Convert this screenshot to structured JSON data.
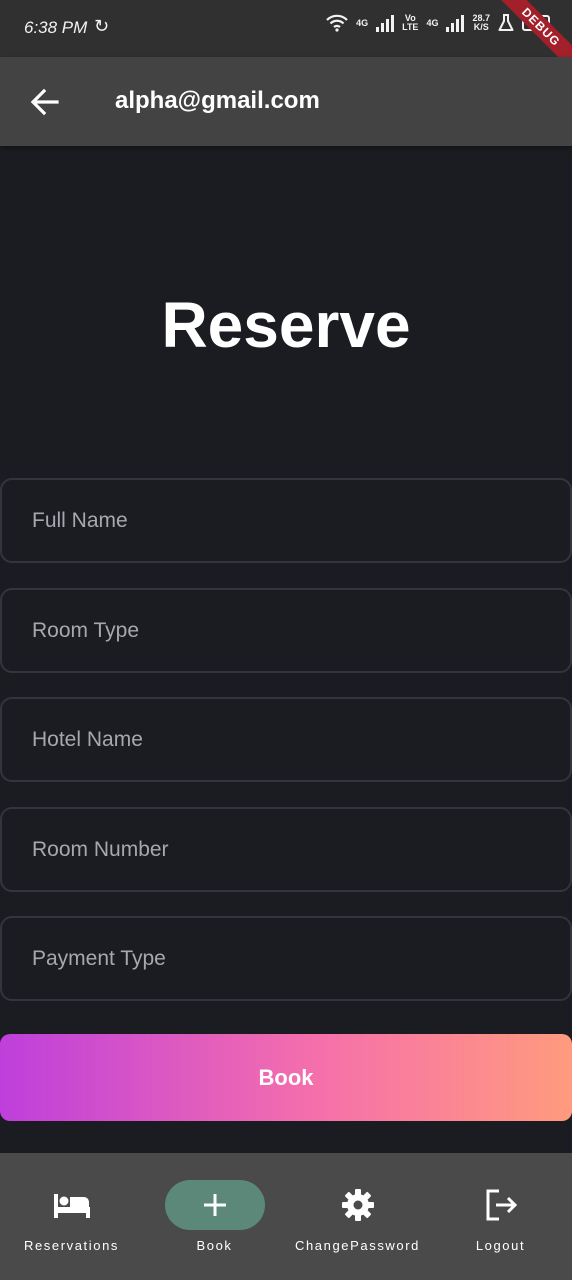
{
  "status_bar": {
    "time": "6:38 PM",
    "net_4g_1": "4G",
    "volte_top": "Vo",
    "volte_bottom": "LTE",
    "net_4g_2": "4G",
    "speed_value": "28.7",
    "speed_unit": "K/S",
    "battery": "100"
  },
  "debug_banner": "DEBUG",
  "app_bar": {
    "title": "alpha@gmail.com"
  },
  "page": {
    "title": "Reserve"
  },
  "form": {
    "fields": [
      {
        "placeholder": "Full Name",
        "value": ""
      },
      {
        "placeholder": "Room Type",
        "value": ""
      },
      {
        "placeholder": "Hotel Name",
        "value": ""
      },
      {
        "placeholder": "Room Number",
        "value": ""
      },
      {
        "placeholder": "Payment Type",
        "value": ""
      }
    ],
    "submit_label": "Book"
  },
  "bottom_nav": {
    "items": [
      {
        "label": "Reservations",
        "icon": "hotel-bed-icon"
      },
      {
        "label": "Book",
        "icon": "plus-icon",
        "active": true
      },
      {
        "label": "ChangePassword",
        "icon": "gear-icon"
      },
      {
        "label": "Logout",
        "icon": "logout-icon"
      }
    ],
    "active_color": "#5b8879"
  },
  "colors": {
    "background": "#1b1b22",
    "app_bar": "#434343",
    "gradient_start": "#be3fdc",
    "gradient_end": "#ff9b7e"
  }
}
